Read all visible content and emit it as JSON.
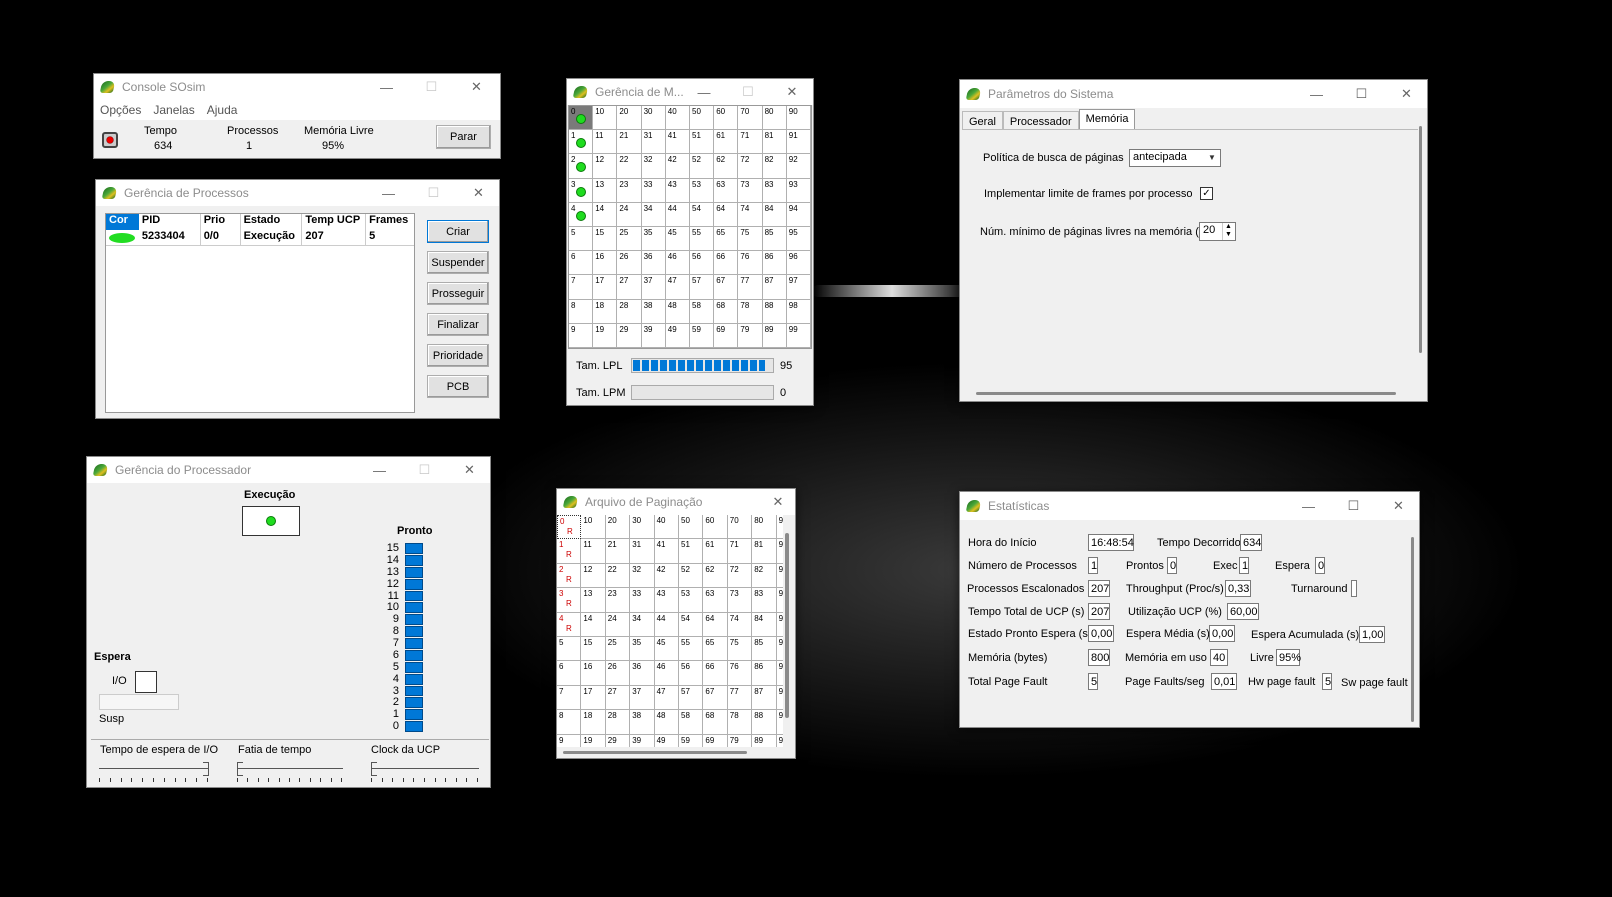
{
  "colors": {
    "accent": "#0078d7",
    "running": "#22dd22",
    "ready_bar": "#0078d7",
    "page_fault": "#cc0000"
  },
  "console": {
    "title": "Console SOsim",
    "menu": [
      "Opções",
      "Janelas",
      "Ajuda"
    ],
    "labels": {
      "tempo": "Tempo",
      "processos": "Processos",
      "memoria": "Memória Livre"
    },
    "values": {
      "tempo": "634",
      "processos": "1",
      "memoria": "95%"
    },
    "parar": "Parar"
  },
  "processos": {
    "title": "Gerência de Processos",
    "headers": [
      "Cor",
      "PID",
      "Prio",
      "Estado",
      "Temp UCP",
      "Frames"
    ],
    "row": {
      "pid": "5233404",
      "prio": "0/0",
      "estado": "Execução",
      "temp": "207",
      "frames": "5"
    },
    "buttons": [
      "Criar",
      "Suspender",
      "Prosseguir",
      "Finalizar",
      "Prioridade",
      "PCB"
    ]
  },
  "processador": {
    "title": "Gerência do Processador",
    "execucao": "Execução",
    "pronto": "Pronto",
    "espera": "Espera",
    "io": "I/O",
    "susp": "Susp",
    "ready_levels": [
      "15",
      "14",
      "13",
      "12",
      "11",
      "10",
      "9",
      "8",
      "7",
      "6",
      "5",
      "4",
      "3",
      "2",
      "1",
      "0"
    ],
    "sliders": [
      "Tempo de espera de I/O",
      "Fatia de tempo",
      "Clock da UCP"
    ]
  },
  "memoria": {
    "title": "Gerência de M...",
    "lpl_label": "Tam. LPL",
    "lpl_value": "95",
    "lpl_fill": 0.95,
    "lpm_label": "Tam. LPM",
    "lpm_value": "0",
    "lpm_fill": 0,
    "cells": [
      "0",
      "10",
      "20",
      "30",
      "40",
      "50",
      "60",
      "70",
      "80",
      "90",
      "1",
      "11",
      "21",
      "31",
      "41",
      "51",
      "61",
      "71",
      "81",
      "91",
      "2",
      "12",
      "22",
      "32",
      "42",
      "52",
      "62",
      "72",
      "82",
      "92",
      "3",
      "13",
      "23",
      "33",
      "43",
      "53",
      "63",
      "73",
      "83",
      "93",
      "4",
      "14",
      "24",
      "34",
      "44",
      "54",
      "64",
      "74",
      "84",
      "94",
      "5",
      "15",
      "25",
      "35",
      "45",
      "55",
      "65",
      "75",
      "85",
      "95",
      "6",
      "16",
      "26",
      "36",
      "46",
      "56",
      "66",
      "76",
      "86",
      "96",
      "7",
      "17",
      "27",
      "37",
      "47",
      "57",
      "67",
      "77",
      "87",
      "97",
      "8",
      "18",
      "28",
      "38",
      "48",
      "58",
      "68",
      "78",
      "88",
      "98",
      "9",
      "19",
      "29",
      "39",
      "49",
      "59",
      "69",
      "79",
      "89",
      "99"
    ]
  },
  "paginacao": {
    "title": "Arquivo de Paginação",
    "marker": "R",
    "cells": [
      "0",
      "10",
      "20",
      "30",
      "40",
      "50",
      "60",
      "70",
      "80",
      "9",
      "1",
      "11",
      "21",
      "31",
      "41",
      "51",
      "61",
      "71",
      "81",
      "9",
      "2",
      "12",
      "22",
      "32",
      "42",
      "52",
      "62",
      "72",
      "82",
      "9",
      "3",
      "13",
      "23",
      "33",
      "43",
      "53",
      "63",
      "73",
      "83",
      "9",
      "4",
      "14",
      "24",
      "34",
      "44",
      "54",
      "64",
      "74",
      "84",
      "9",
      "5",
      "15",
      "25",
      "35",
      "45",
      "55",
      "65",
      "75",
      "85",
      "9",
      "6",
      "16",
      "26",
      "36",
      "46",
      "56",
      "66",
      "76",
      "86",
      "9",
      "7",
      "17",
      "27",
      "37",
      "47",
      "57",
      "67",
      "77",
      "87",
      "9",
      "8",
      "18",
      "28",
      "38",
      "48",
      "58",
      "68",
      "78",
      "88",
      "9",
      "9",
      "19",
      "29",
      "39",
      "49",
      "59",
      "69",
      "79",
      "89",
      "9"
    ]
  },
  "parametros": {
    "title": "Parâmetros do Sistema",
    "tabs": [
      "Geral",
      "Processador",
      "Memória"
    ],
    "politica_label": "Política de busca de páginas",
    "politica_value": "antecipada",
    "limite_label": "Implementar limite de frames por processo",
    "limite_checked": "✓",
    "min_label": "Núm. mínimo de páginas livres na memória (%)",
    "min_value": "20"
  },
  "estatisticas": {
    "title": "Estatísticas",
    "hora_inicio": "Hora do Início",
    "hora_inicio_v": "16:48:54",
    "tempo_dec": "Tempo Decorrido",
    "tempo_dec_v": "634",
    "num_proc": "Número de Processos",
    "num_proc_v": "1",
    "prontos": "Prontos",
    "prontos_v": "0",
    "exec": "Exec",
    "exec_v": "1",
    "espera": "Espera",
    "espera_v": "0",
    "escalonados": "Processos Escalonados",
    "escalonados_v": "207",
    "throughput": "Throughput (Proc/s)",
    "throughput_v": "0,33",
    "turnaround": "Turnaround",
    "turnaround_v": "",
    "tempo_ucp": "Tempo Total de UCP (s)",
    "tempo_ucp_v": "207",
    "util_ucp": "Utilização UCP (%)",
    "util_ucp_v": "60,00",
    "pronto_espera": "Estado Pronto Espera (s)",
    "pronto_espera_v": "0,00",
    "espera_media": "Espera Média (s)",
    "espera_media_v": "0,00",
    "espera_acum": "Espera Acumulada (s)",
    "espera_acum_v": "1,00",
    "memoria": "Memória (bytes)",
    "memoria_v": "800",
    "mem_uso": "Memória em uso",
    "mem_uso_v": "40",
    "livre": "Livre",
    "livre_v": "95%",
    "total_pf": "Total Page Fault",
    "total_pf_v": "5",
    "pf_seg": "Page Faults/seg",
    "pf_seg_v": "0,01",
    "hw_pf": "Hw page fault",
    "hw_pf_v": "5",
    "sw_pf": "Sw page fault"
  }
}
